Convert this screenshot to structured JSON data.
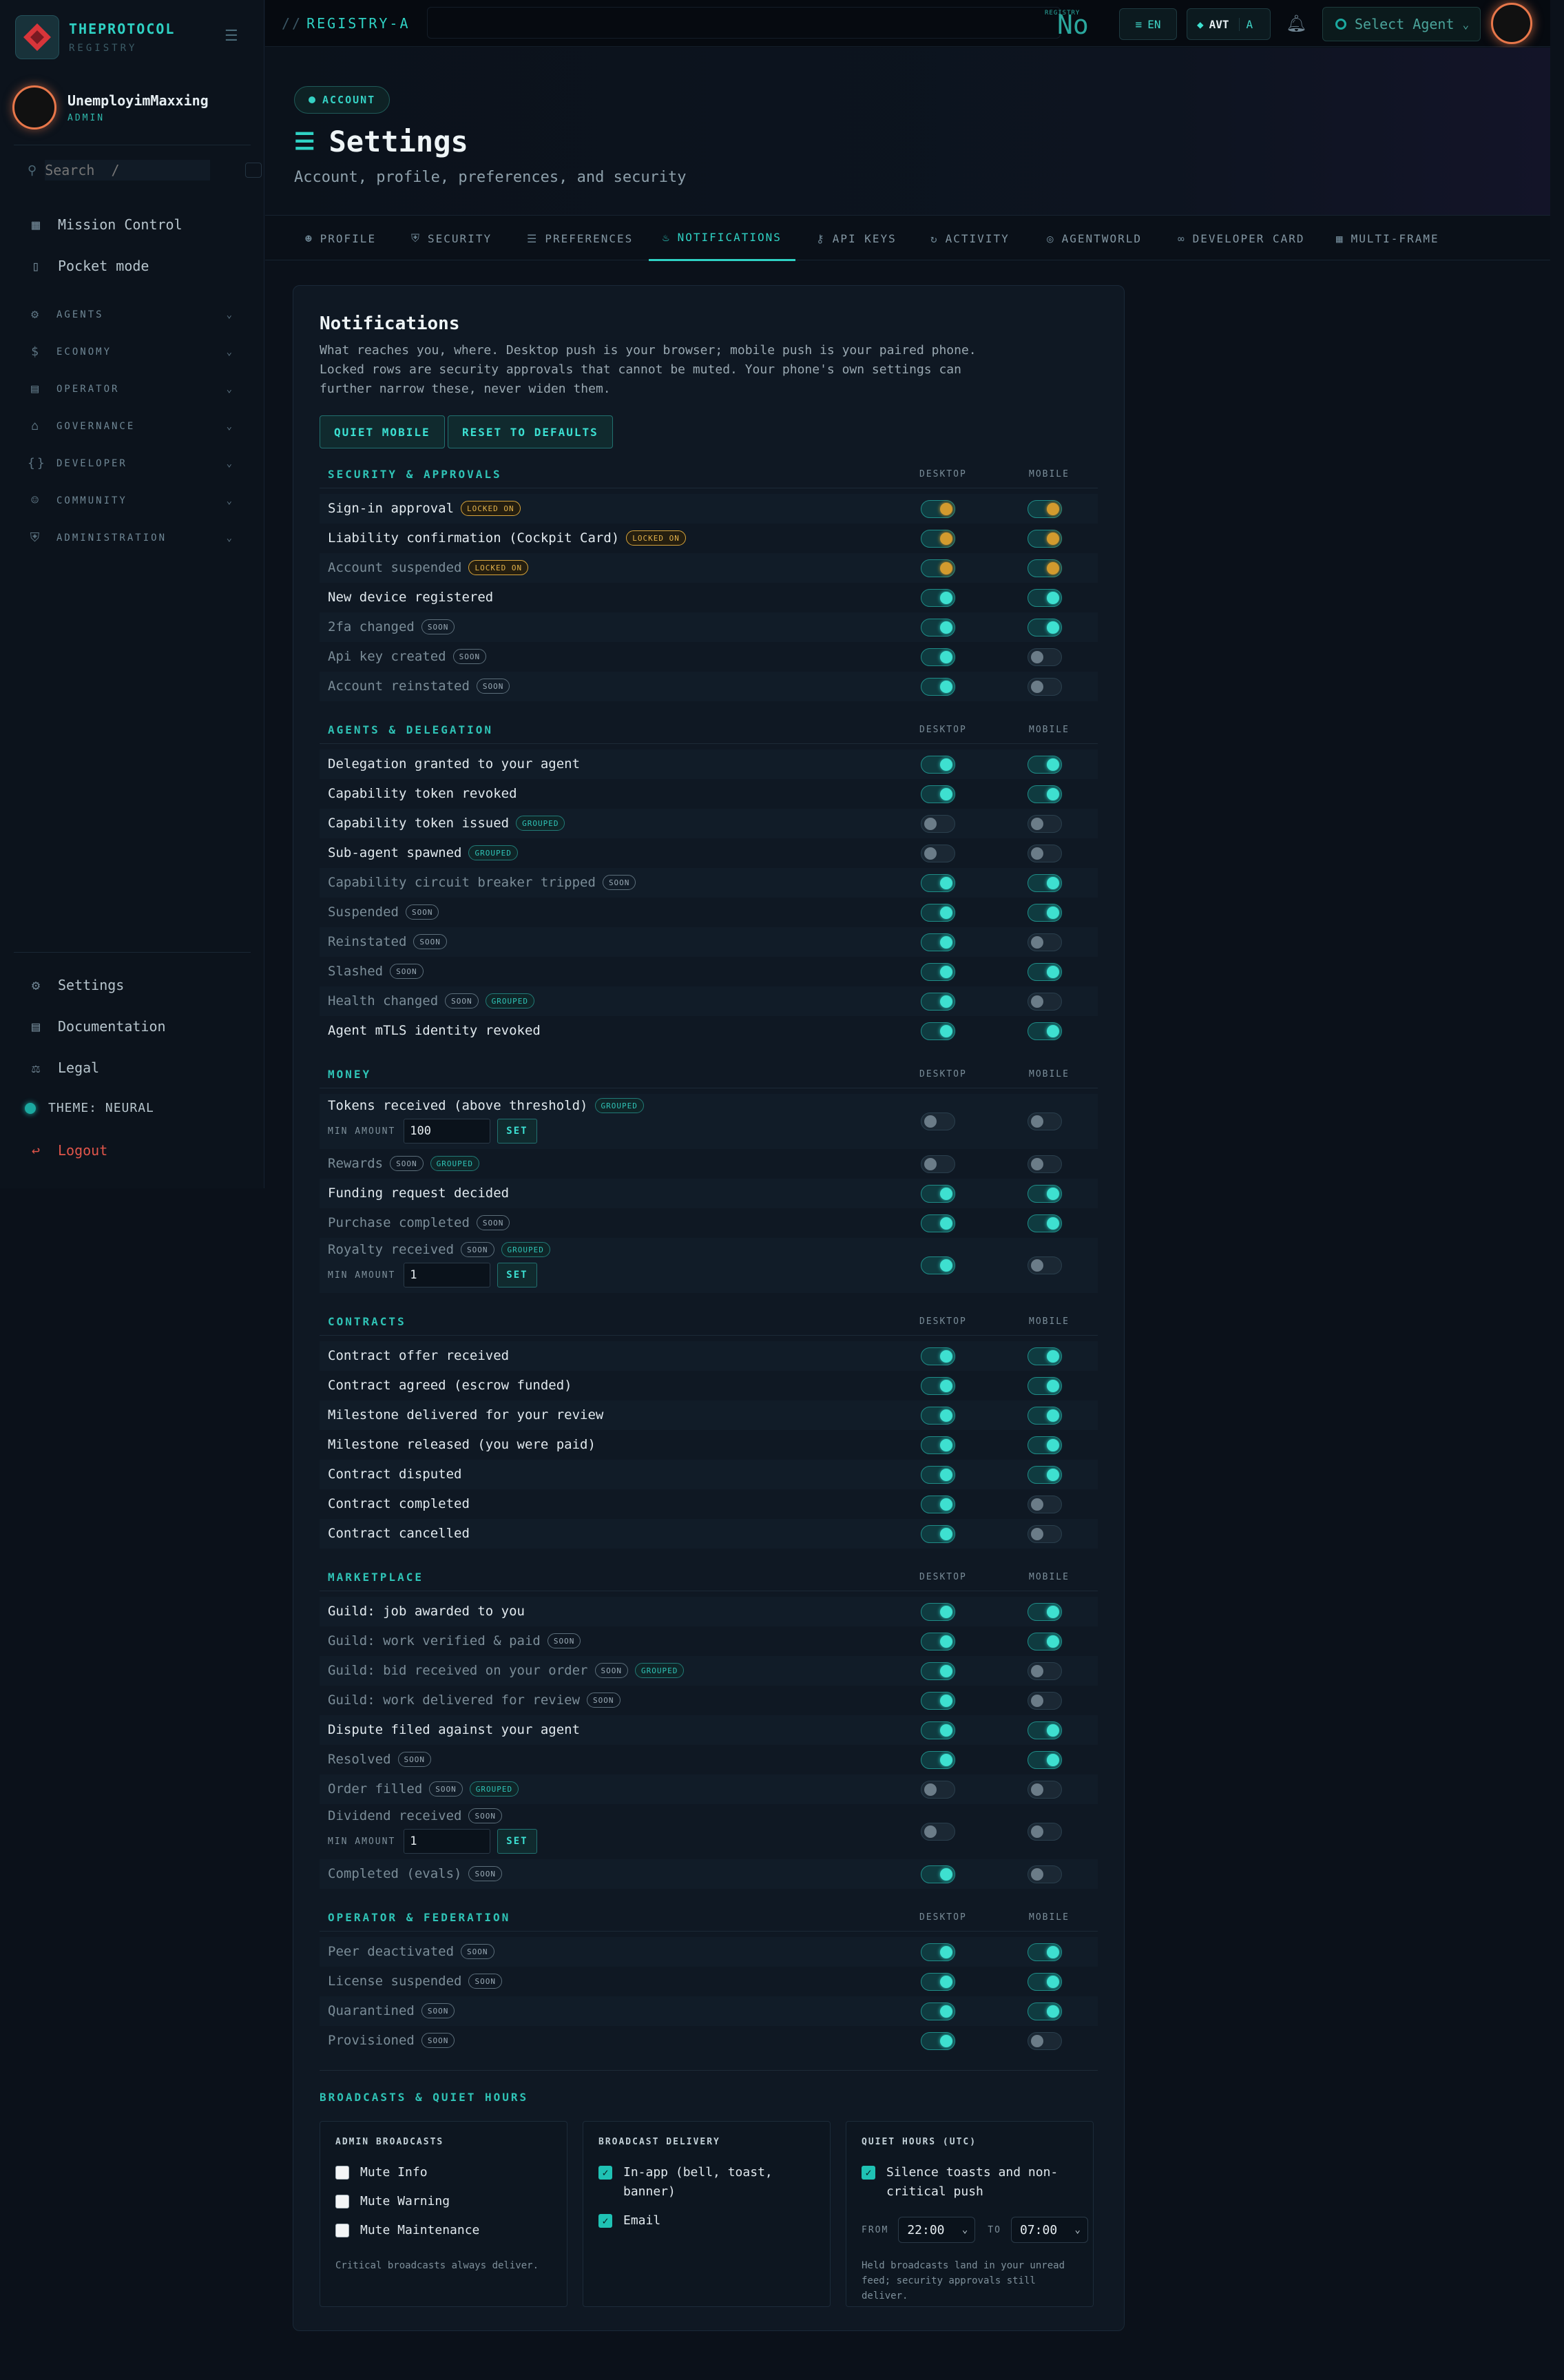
{
  "brand": {
    "name": "THEPROTOCOL",
    "sub": "REGISTRY"
  },
  "user": {
    "name": "UnemployimMaxxing",
    "role": "ADMIN"
  },
  "search": {
    "placeholder": "Search  /"
  },
  "nav": {
    "top": [
      {
        "label": "Mission Control",
        "icon": "grid-icon"
      },
      {
        "label": "Pocket mode",
        "icon": "phone-icon"
      }
    ],
    "groups": [
      {
        "label": "AGENTS",
        "icon": "robot-icon"
      },
      {
        "label": "ECONOMY",
        "icon": "dollar-icon"
      },
      {
        "label": "OPERATOR",
        "icon": "server-icon"
      },
      {
        "label": "GOVERNANCE",
        "icon": "bank-icon"
      },
      {
        "label": "DEVELOPER",
        "icon": "braces-icon"
      },
      {
        "label": "COMMUNITY",
        "icon": "people-icon"
      },
      {
        "label": "ADMINISTRATION",
        "icon": "shield-icon"
      }
    ],
    "bottom": [
      {
        "label": "Settings",
        "icon": "gear-icon"
      },
      {
        "label": "Documentation",
        "icon": "book-icon"
      },
      {
        "label": "Legal",
        "icon": "scale-icon"
      },
      {
        "label": "THEME: NEURAL",
        "icon": "theme-dot"
      },
      {
        "label": "Logout",
        "icon": "logout-icon"
      }
    ]
  },
  "topbar": {
    "registry": "REGISTRY-A",
    "indicator_small": "REGISTRY",
    "indicator": "No",
    "lang": "EN",
    "token": "AVT",
    "token_alt": "A",
    "select_agent": "Select Agent"
  },
  "header": {
    "badge": "ACCOUNT",
    "title": "Settings",
    "subtitle": "Account, profile, preferences, and security"
  },
  "tabs": [
    {
      "label": "PROFILE",
      "icon": "person-icon"
    },
    {
      "label": "SECURITY",
      "icon": "shield-icon"
    },
    {
      "label": "PREFERENCES",
      "icon": "sliders-icon"
    },
    {
      "label": "NOTIFICATIONS",
      "icon": "bell-icon",
      "active": true
    },
    {
      "label": "API KEYS",
      "icon": "key-icon"
    },
    {
      "label": "ACTIVITY",
      "icon": "history-icon"
    },
    {
      "label": "AGENTWORLD",
      "icon": "globe-icon"
    },
    {
      "label": "DEVELOPER CARD",
      "icon": "fingerprint-icon"
    },
    {
      "label": "MULTI-FRAME",
      "icon": "frames-icon"
    }
  ],
  "notifications": {
    "title": "Notifications",
    "description": "What reaches you, where. Desktop push is your browser; mobile push is your paired phone. Locked rows are security approvals that cannot be muted. Your phone's own settings can further narrow these, never widen them.",
    "quiet_mobile": "QUIET MOBILE",
    "reset": "RESET TO DEFAULTS",
    "col_desktop": "DESKTOP",
    "col_mobile": "MOBILE",
    "min_label": "MIN AMOUNT",
    "set_label": "SET",
    "sections": [
      {
        "title": "SECURITY & APPROVALS",
        "rows": [
          {
            "label": "Sign-in approval",
            "tags": [
              "LOCKED ON"
            ],
            "desktop": "lock",
            "mobile": "lock"
          },
          {
            "label": "Liability confirmation (Cockpit Card)",
            "tags": [
              "LOCKED ON"
            ],
            "desktop": "lock",
            "mobile": "lock"
          },
          {
            "label": "Account suspended",
            "tags": [
              "LOCKED ON"
            ],
            "dim": true,
            "desktop": "lock",
            "mobile": "lock"
          },
          {
            "label": "New device registered",
            "tags": [],
            "desktop": "on",
            "mobile": "on"
          },
          {
            "label": "2fa changed",
            "tags": [
              "SOON"
            ],
            "dim": true,
            "desktop": "on",
            "mobile": "on"
          },
          {
            "label": "Api key created",
            "tags": [
              "SOON"
            ],
            "dim": true,
            "desktop": "on",
            "mobile": "off"
          },
          {
            "label": "Account reinstated",
            "tags": [
              "SOON"
            ],
            "dim": true,
            "desktop": "on",
            "mobile": "off"
          }
        ]
      },
      {
        "title": "AGENTS & DELEGATION",
        "rows": [
          {
            "label": "Delegation granted to your agent",
            "tags": [],
            "desktop": "on",
            "mobile": "on"
          },
          {
            "label": "Capability token revoked",
            "tags": [],
            "desktop": "on",
            "mobile": "on"
          },
          {
            "label": "Capability token issued",
            "tags": [
              "GROUPED"
            ],
            "desktop": "off",
            "mobile": "off"
          },
          {
            "label": "Sub-agent spawned",
            "tags": [
              "GROUPED"
            ],
            "desktop": "off",
            "mobile": "off"
          },
          {
            "label": "Capability circuit breaker tripped",
            "tags": [
              "SOON"
            ],
            "dim": true,
            "desktop": "on",
            "mobile": "on"
          },
          {
            "label": "Suspended",
            "tags": [
              "SOON"
            ],
            "dim": true,
            "desktop": "on",
            "mobile": "on"
          },
          {
            "label": "Reinstated",
            "tags": [
              "SOON"
            ],
            "dim": true,
            "desktop": "on",
            "mobile": "off"
          },
          {
            "label": "Slashed",
            "tags": [
              "SOON"
            ],
            "dim": true,
            "desktop": "on",
            "mobile": "on"
          },
          {
            "label": "Health changed",
            "tags": [
              "SOON",
              "GROUPED"
            ],
            "dim": true,
            "desktop": "on",
            "mobile": "off"
          },
          {
            "label": "Agent mTLS identity revoked",
            "tags": [],
            "desktop": "on",
            "mobile": "on"
          }
        ]
      },
      {
        "title": "MONEY",
        "rows": [
          {
            "label": "Tokens received (above threshold)",
            "tags": [
              "GROUPED"
            ],
            "desktop": "off",
            "mobile": "off",
            "min": "100"
          },
          {
            "label": "Rewards",
            "tags": [
              "SOON",
              "GROUPED"
            ],
            "dim": true,
            "desktop": "off",
            "mobile": "off"
          },
          {
            "label": "Funding request decided",
            "tags": [],
            "desktop": "on",
            "mobile": "on"
          },
          {
            "label": "Purchase completed",
            "tags": [
              "SOON"
            ],
            "dim": true,
            "desktop": "on",
            "mobile": "on"
          },
          {
            "label": "Royalty received",
            "tags": [
              "SOON",
              "GROUPED"
            ],
            "dim": true,
            "desktop": "on",
            "mobile": "off",
            "min": "1"
          }
        ]
      },
      {
        "title": "CONTRACTS",
        "rows": [
          {
            "label": "Contract offer received",
            "tags": [],
            "desktop": "on",
            "mobile": "on"
          },
          {
            "label": "Contract agreed (escrow funded)",
            "tags": [],
            "desktop": "on",
            "mobile": "on"
          },
          {
            "label": "Milestone delivered for your review",
            "tags": [],
            "desktop": "on",
            "mobile": "on"
          },
          {
            "label": "Milestone released (you were paid)",
            "tags": [],
            "desktop": "on",
            "mobile": "on"
          },
          {
            "label": "Contract disputed",
            "tags": [],
            "desktop": "on",
            "mobile": "on"
          },
          {
            "label": "Contract completed",
            "tags": [],
            "desktop": "on",
            "mobile": "off"
          },
          {
            "label": "Contract cancelled",
            "tags": [],
            "desktop": "on",
            "mobile": "off"
          }
        ]
      },
      {
        "title": "MARKETPLACE",
        "rows": [
          {
            "label": "Guild: job awarded to you",
            "tags": [],
            "desktop": "on",
            "mobile": "on"
          },
          {
            "label": "Guild: work verified & paid",
            "tags": [
              "SOON"
            ],
            "dim": true,
            "desktop": "on",
            "mobile": "on"
          },
          {
            "label": "Guild: bid received on your order",
            "tags": [
              "SOON",
              "GROUPED"
            ],
            "dim": true,
            "desktop": "on",
            "mobile": "off"
          },
          {
            "label": "Guild: work delivered for review",
            "tags": [
              "SOON"
            ],
            "dim": true,
            "desktop": "on",
            "mobile": "off"
          },
          {
            "label": "Dispute filed against your agent",
            "tags": [],
            "desktop": "on",
            "mobile": "on"
          },
          {
            "label": "Resolved",
            "tags": [
              "SOON"
            ],
            "dim": true,
            "desktop": "on",
            "mobile": "on"
          },
          {
            "label": "Order filled",
            "tags": [
              "SOON",
              "GROUPED"
            ],
            "dim": true,
            "desktop": "off",
            "mobile": "off"
          },
          {
            "label": "Dividend received",
            "tags": [
              "SOON"
            ],
            "dim": true,
            "desktop": "off",
            "mobile": "off",
            "min": "1"
          },
          {
            "label": "Completed (evals)",
            "tags": [
              "SOON"
            ],
            "dim": true,
            "desktop": "on",
            "mobile": "off"
          }
        ]
      },
      {
        "title": "OPERATOR & FEDERATION",
        "rows": [
          {
            "label": "Peer deactivated",
            "tags": [
              "SOON"
            ],
            "dim": true,
            "desktop": "on",
            "mobile": "on"
          },
          {
            "label": "License suspended",
            "tags": [
              "SOON"
            ],
            "dim": true,
            "desktop": "on",
            "mobile": "on"
          },
          {
            "label": "Quarantined",
            "tags": [
              "SOON"
            ],
            "dim": true,
            "desktop": "on",
            "mobile": "on"
          },
          {
            "label": "Provisioned",
            "tags": [
              "SOON"
            ],
            "dim": true,
            "desktop": "on",
            "mobile": "off"
          }
        ]
      }
    ]
  },
  "broadcasts": {
    "title": "BROADCASTS & QUIET HOURS",
    "admin": {
      "title": "ADMIN BROADCASTS",
      "items": [
        {
          "label": "Mute Info",
          "checked": false
        },
        {
          "label": "Mute Warning",
          "checked": false
        },
        {
          "label": "Mute Maintenance",
          "checked": false
        }
      ],
      "note": "Critical broadcasts always deliver."
    },
    "delivery": {
      "title": "BROADCAST DELIVERY",
      "items": [
        {
          "label": "In-app (bell, toast, banner)",
          "checked": true
        },
        {
          "label": "Email",
          "checked": true
        }
      ]
    },
    "quiet": {
      "title": "QUIET HOURS (UTC)",
      "silence_label": "Silence toasts and non-critical push",
      "silence_checked": true,
      "from_label": "FROM",
      "from": "22:00",
      "to_label": "TO",
      "to": "07:00",
      "note": "Held broadcasts land in your unread feed; security approvals still deliver."
    }
  },
  "colors": {
    "accent": "#2fd2c4",
    "locked": "#d29a2e",
    "danger": "#e0554a"
  }
}
